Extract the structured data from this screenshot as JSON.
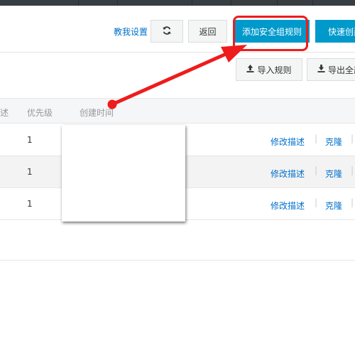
{
  "toolbar": {
    "help_link": "教我设置",
    "refresh_icon": "refresh-icon",
    "back_label": "返回",
    "add_rule_label": "添加安全组规则",
    "quick_create_label": "快速创建"
  },
  "secondary_toolbar": {
    "import_label": "导入规则",
    "import_icon": "upload-icon",
    "export_label": "导出全部",
    "export_icon": "download-icon"
  },
  "table": {
    "headers": {
      "description": "述",
      "priority": "优先级",
      "created_time": "创建时间"
    },
    "rows": [
      {
        "priority": "1",
        "action_edit": "修改描述",
        "action_clone": "克隆"
      },
      {
        "priority": "1",
        "action_edit": "修改描述",
        "action_clone": "克隆"
      },
      {
        "priority": "1",
        "action_edit": "修改描述",
        "action_clone": "克隆"
      }
    ]
  },
  "annotation": {
    "color": "#ee1c1c"
  }
}
